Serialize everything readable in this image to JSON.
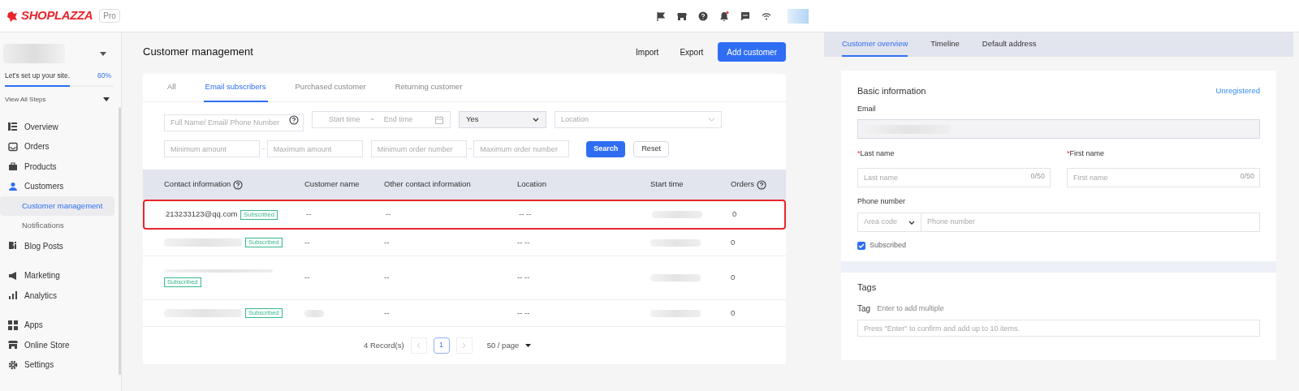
{
  "header": {
    "logo": "SHOPLAZZA",
    "plan": "Pro"
  },
  "sidebar": {
    "setup": {
      "label": "Let's set up your site.",
      "percent": "60%",
      "level": 0.6
    },
    "view_steps": "View All Steps",
    "groups": [
      [
        {
          "label": "Overview",
          "selected": false
        },
        {
          "label": "Orders",
          "selected": false
        },
        {
          "label": "Products",
          "selected": false
        },
        {
          "label": "Customers",
          "selected": false,
          "children": [
            {
              "label": "Customer management",
              "selected": true
            },
            {
              "label": "Notifications",
              "selected": false
            }
          ]
        },
        {
          "label": "Blog Posts",
          "selected": false
        }
      ],
      [
        {
          "label": "Marketing",
          "selected": false
        },
        {
          "label": "Analytics",
          "selected": false
        }
      ],
      [
        {
          "label": "Apps",
          "selected": false
        },
        {
          "label": "Online Store",
          "selected": false
        },
        {
          "label": "Settings",
          "selected": false
        }
      ]
    ]
  },
  "main": {
    "title": "Customer management",
    "actions": [
      "Import",
      "Export"
    ],
    "primary_action": "Add customer",
    "tabs": [
      {
        "label": "All",
        "selected": false
      },
      {
        "label": "Email subscribers",
        "selected": true
      },
      {
        "label": "Purchased customer",
        "selected": false
      },
      {
        "label": "Returning customer",
        "selected": false
      }
    ],
    "filters": {
      "search_placeholder": "Full Name/ Email/ Phone Number",
      "start_placeholder": "Start time",
      "range_sep": "~",
      "end_placeholder": "End time",
      "subscribed_value": "Yes",
      "location_placeholder": "Location",
      "min_amount_placeholder": "Minimum amount",
      "max_amount_placeholder": "Maximum amount",
      "min_orders_placeholder": "Minimum order number",
      "max_orders_placeholder": "Maximum order number",
      "search": "Search",
      "reset": "Reset"
    },
    "table": {
      "columns": [
        {
          "label": "Contact information",
          "help": true
        },
        {
          "label": "Customer name",
          "help": false
        },
        {
          "label": "Other contact information",
          "help": false
        },
        {
          "label": "Location",
          "help": false
        },
        {
          "label": "Start time",
          "help": false
        },
        {
          "label": "Orders",
          "help": true
        }
      ],
      "rows": [
        {
          "contact": "213233123@qq.com",
          "tag": "Subscribed",
          "name": "--",
          "other": "--",
          "location": "-- --",
          "orders": "0",
          "highlighted": true,
          "wrapped": false
        },
        {
          "tag": "Subscribed",
          "name": "--",
          "other": "--",
          "location": "-- --",
          "orders": "0",
          "highlighted": false,
          "wrapped": false
        },
        {
          "tag": "Subscribed",
          "name": "--",
          "other": "--",
          "location": "-- --",
          "orders": "0",
          "highlighted": false,
          "wrapped": true
        },
        {
          "tag": "Subscribed",
          "other": "--",
          "location": "-- --",
          "orders": "0",
          "highlighted": false,
          "wrapped": false
        }
      ]
    },
    "pagination": {
      "records": "4 Record(s)",
      "pages": [
        {
          "label": "1",
          "selected": true
        }
      ],
      "page_size": "50 / page"
    }
  },
  "detail": {
    "tabs": [
      {
        "label": "Customer overview",
        "selected": true
      },
      {
        "label": "Timeline",
        "selected": false
      },
      {
        "label": "Default address",
        "selected": false
      }
    ],
    "basic": {
      "title": "Basic information",
      "status": "Unregistered",
      "email_label": "Email",
      "last_label": "Last name",
      "last_required": true,
      "last_required_mark": "*",
      "last_placeholder": "Last name",
      "last_count": "0/50",
      "first_label": "First name",
      "first_required": true,
      "first_required_mark": "*",
      "first_placeholder": "First name",
      "first_count": "0/50",
      "phone_label": "Phone number",
      "area_placeholder": "Area code",
      "phone_placeholder": "Phone number",
      "subscribed_label": "Subscribed",
      "subscribed_checked": true
    },
    "tags": {
      "title": "Tags",
      "label": "Tag",
      "hint": "Enter to add multiple",
      "placeholder": "Press \"Enter\" to confirm and add up to 10 items."
    }
  }
}
